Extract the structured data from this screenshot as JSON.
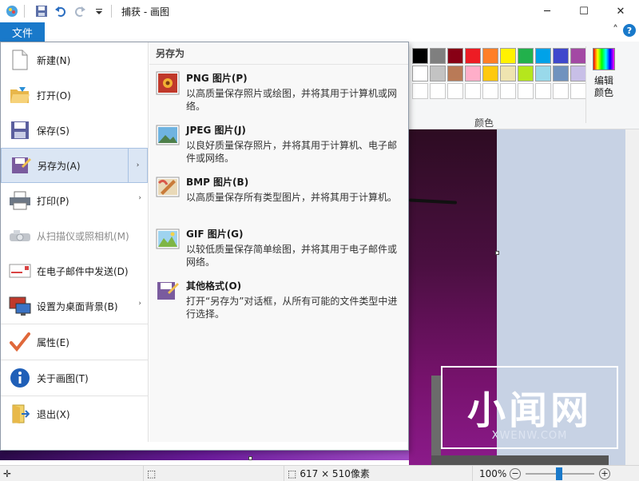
{
  "window": {
    "title": "捕获 - 画图",
    "minimize": "─",
    "maximize": "☐",
    "close": "✕"
  },
  "ribbon": {
    "file_tab": "文件",
    "collapse": "˄",
    "help": "?",
    "colors_label": "颜色",
    "edit_colors_line1": "编辑",
    "edit_colors_line2": "颜色",
    "palette_row1": [
      "#000000",
      "#7f7f7f",
      "#880015",
      "#ed1c24",
      "#ff7f27",
      "#fff200",
      "#22b14c",
      "#00a2e8",
      "#3f48cc",
      "#a349a4"
    ],
    "palette_row2": [
      "#ffffff",
      "#c3c3c3",
      "#b97a57",
      "#ffaec9",
      "#ffc90e",
      "#efe4b0",
      "#b5e61d",
      "#99d9ea",
      "#7092be",
      "#c8bfe7"
    ]
  },
  "file_menu": {
    "items": [
      {
        "label": "新建(N)",
        "icon": "new-file-icon"
      },
      {
        "label": "打开(O)",
        "icon": "open-folder-icon"
      },
      {
        "label": "保存(S)",
        "icon": "save-disk-icon"
      },
      {
        "label": "另存为(A)",
        "icon": "save-as-icon",
        "submenu": "›"
      },
      {
        "label": "打印(P)",
        "icon": "printer-icon",
        "submenu": "›"
      },
      {
        "label": "从扫描仪或照相机(M)",
        "icon": "scanner-icon"
      },
      {
        "label": "在电子邮件中发送(D)",
        "icon": "email-icon"
      },
      {
        "label": "设置为桌面背景(B)",
        "icon": "desktop-background-icon",
        "submenu": "›"
      },
      {
        "label": "属性(E)",
        "icon": "checkmark-icon"
      },
      {
        "label": "关于画图(T)",
        "icon": "info-icon"
      },
      {
        "label": "退出(X)",
        "icon": "exit-icon"
      }
    ],
    "submenu_title": "另存为",
    "submenu_items": [
      {
        "title": "PNG 图片(P)",
        "desc": "以高质量保存照片或绘图，并将其用于计算机或网络。"
      },
      {
        "title": "JPEG 图片(J)",
        "desc": "以良好质量保存照片，并将其用于计算机、电子邮件或网络。"
      },
      {
        "title": "BMP 图片(B)",
        "desc": "以高质量保存所有类型图片，并将其用于计算机。"
      },
      {
        "title": "GIF 图片(G)",
        "desc": "以较低质量保存简单绘图，并将其用于电子邮件或网络。"
      },
      {
        "title": "其他格式(O)",
        "desc": "打开“另存为”对话框，从所有可能的文件类型中进行选择。"
      }
    ]
  },
  "watermark": {
    "big": "小闻网",
    "small": "XWENW.COM"
  },
  "status": {
    "add_icon": "✛",
    "select_icon": "⬚",
    "size_icon": "⬚",
    "size": "617 × 510像素",
    "zoom": "100%",
    "zoom_out": "−",
    "zoom_in": "+"
  }
}
